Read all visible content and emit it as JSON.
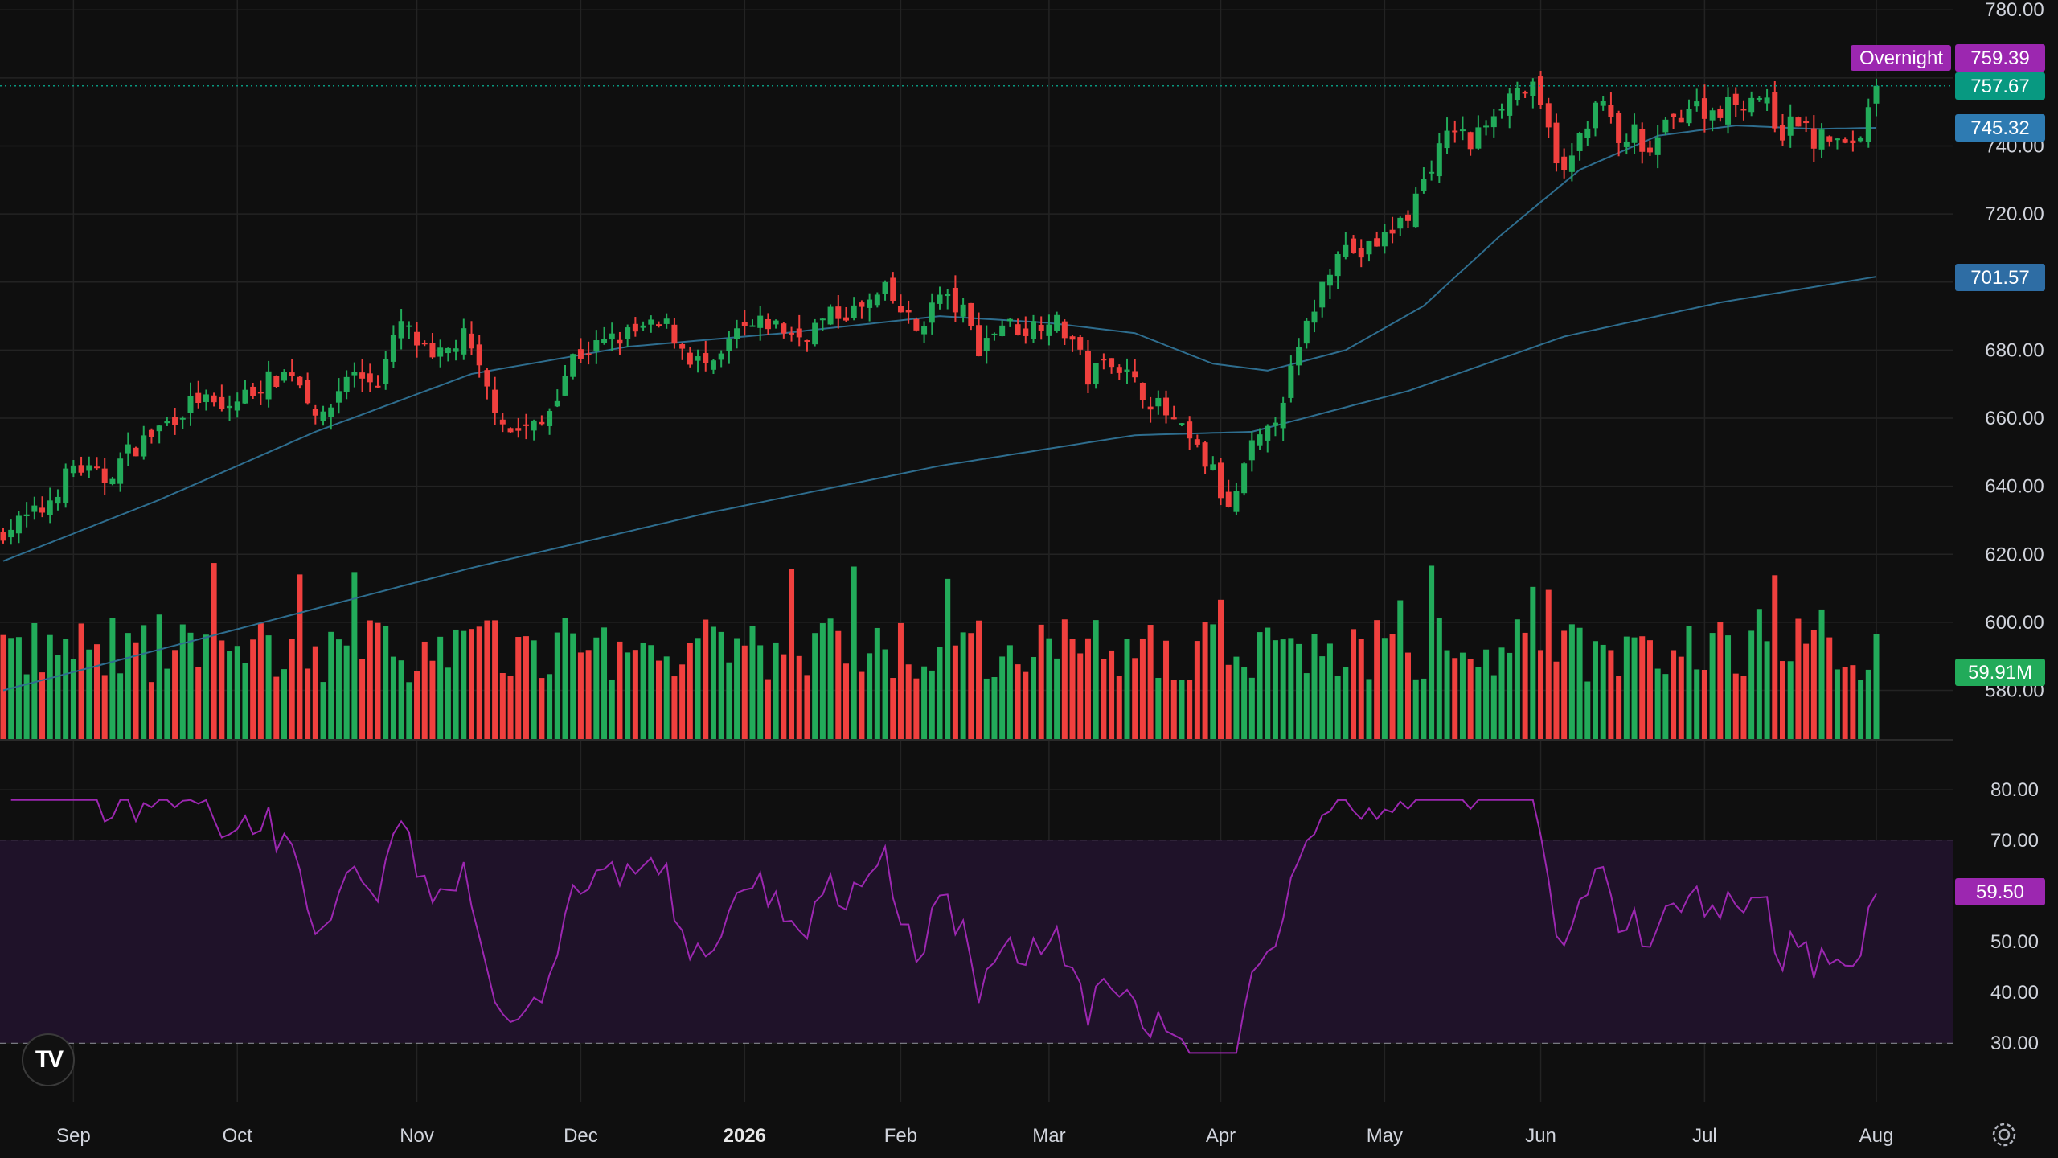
{
  "colors": {
    "background": "#0f0f0f",
    "grid": "#232323",
    "up": "#22ab5a",
    "down": "#f0403e",
    "ma_line": "#2e6d8e",
    "rsi_line": "#9c27b0",
    "rsi_band": "#1f1229",
    "overnight": "#9c27b0",
    "last_price": "#089981",
    "ma50_tag": "#2e7bb2",
    "ma200_tag": "#2e6da4",
    "volume_tag": "#22ab5a",
    "rsi_tag": "#9c27b0"
  },
  "price_axis": {
    "min": 565,
    "max": 781,
    "ticks": [
      "780.00",
      "740.00",
      "720.00",
      "680.00",
      "660.00",
      "640.00",
      "620.00",
      "600.00",
      "580.00"
    ]
  },
  "rsi_axis": {
    "min": 26,
    "max": 84,
    "ticks": [
      "80.00",
      "70.00",
      "50.00",
      "40.00",
      "30.00"
    ],
    "upper_band": 70,
    "lower_band": 30
  },
  "time_axis": {
    "labels": [
      {
        "text": "Sep",
        "index": 9
      },
      {
        "text": "Oct",
        "index": 30
      },
      {
        "text": "Nov",
        "index": 53
      },
      {
        "text": "Dec",
        "index": 74
      },
      {
        "text": "2026",
        "index": 95,
        "bold": true
      },
      {
        "text": "Feb",
        "index": 115
      },
      {
        "text": "Mar",
        "index": 134
      },
      {
        "text": "Apr",
        "index": 156
      },
      {
        "text": "May",
        "index": 177
      },
      {
        "text": "Jun",
        "index": 197
      },
      {
        "text": "Jul",
        "index": 218
      },
      {
        "text": "Aug",
        "index": 240
      }
    ]
  },
  "tags": {
    "overnight_label": "Overnight",
    "overnight_value": "759.39",
    "last_price": "757.67",
    "ma50": "745.32",
    "ma200": "701.57",
    "volume": "59.91M",
    "rsi": "59.50"
  },
  "logo_text": "TV",
  "chart_data": {
    "type": "candlestick",
    "series_count": 241,
    "price_anchors": [
      [
        0,
        627
      ],
      [
        5,
        633
      ],
      [
        9,
        646
      ],
      [
        13,
        642
      ],
      [
        16,
        650
      ],
      [
        20,
        657
      ],
      [
        25,
        666
      ],
      [
        28,
        662
      ],
      [
        33,
        670
      ],
      [
        37,
        674
      ],
      [
        41,
        659
      ],
      [
        44,
        673
      ],
      [
        48,
        671
      ],
      [
        51,
        688
      ],
      [
        55,
        676
      ],
      [
        59,
        684
      ],
      [
        62,
        668
      ],
      [
        65,
        656
      ],
      [
        69,
        658
      ],
      [
        73,
        678
      ],
      [
        78,
        683
      ],
      [
        82,
        686
      ],
      [
        85,
        687
      ],
      [
        88,
        678
      ],
      [
        91,
        674
      ],
      [
        94,
        685
      ],
      [
        98,
        688
      ],
      [
        102,
        684
      ],
      [
        106,
        690
      ],
      [
        110,
        692
      ],
      [
        113,
        697
      ],
      [
        117,
        686
      ],
      [
        120,
        696
      ],
      [
        123,
        691
      ],
      [
        125,
        681
      ],
      [
        128,
        688
      ],
      [
        131,
        686
      ],
      [
        134,
        690
      ],
      [
        137,
        683
      ],
      [
        139,
        672
      ],
      [
        142,
        678
      ],
      [
        145,
        670
      ],
      [
        149,
        661
      ],
      [
        152,
        653
      ],
      [
        155,
        644
      ],
      [
        157,
        632
      ],
      [
        160,
        651
      ],
      [
        162,
        655
      ],
      [
        165,
        673
      ],
      [
        168,
        693
      ],
      [
        171,
        711
      ],
      [
        174,
        708
      ],
      [
        177,
        713
      ],
      [
        180,
        720
      ],
      [
        183,
        735
      ],
      [
        186,
        746
      ],
      [
        188,
        740
      ],
      [
        191,
        751
      ],
      [
        194,
        757
      ],
      [
        196,
        756
      ],
      [
        198,
        744
      ],
      [
        200,
        731
      ],
      [
        203,
        748
      ],
      [
        205,
        753
      ],
      [
        207,
        740
      ],
      [
        209,
        744
      ],
      [
        210,
        736
      ],
      [
        213,
        745
      ],
      [
        216,
        752
      ],
      [
        219,
        750
      ],
      [
        222,
        753
      ],
      [
        225,
        755
      ],
      [
        228,
        744
      ],
      [
        230,
        748
      ],
      [
        232,
        741
      ],
      [
        234,
        743
      ],
      [
        236,
        739
      ],
      [
        238,
        744
      ],
      [
        240,
        757.67
      ]
    ],
    "moving_averages": [
      {
        "name": "50",
        "points": [
          [
            0,
            618
          ],
          [
            20,
            636
          ],
          [
            40,
            656
          ],
          [
            60,
            673
          ],
          [
            80,
            681
          ],
          [
            100,
            685
          ],
          [
            120,
            690
          ],
          [
            134,
            688
          ],
          [
            145,
            685
          ],
          [
            155,
            676
          ],
          [
            162,
            674
          ],
          [
            172,
            680
          ],
          [
            182,
            693
          ],
          [
            192,
            714
          ],
          [
            202,
            733
          ],
          [
            212,
            743
          ],
          [
            222,
            746
          ],
          [
            232,
            745
          ],
          [
            240,
            745.32
          ]
        ]
      },
      {
        "name": "200",
        "points": [
          [
            0,
            580
          ],
          [
            30,
            598
          ],
          [
            60,
            616
          ],
          [
            90,
            632
          ],
          [
            120,
            646
          ],
          [
            145,
            655
          ],
          [
            160,
            656
          ],
          [
            180,
            668
          ],
          [
            200,
            684
          ],
          [
            220,
            694
          ],
          [
            240,
            701.57
          ]
        ]
      }
    ],
    "volume": {
      "max_units": 100,
      "last": "59.91M"
    },
    "rsi": {
      "last": 59.5,
      "overbought": 70,
      "oversold": 30
    },
    "key_levels": {
      "overnight": 759.39,
      "last": 757.67,
      "ma50": 745.32,
      "ma200": 701.57
    }
  }
}
